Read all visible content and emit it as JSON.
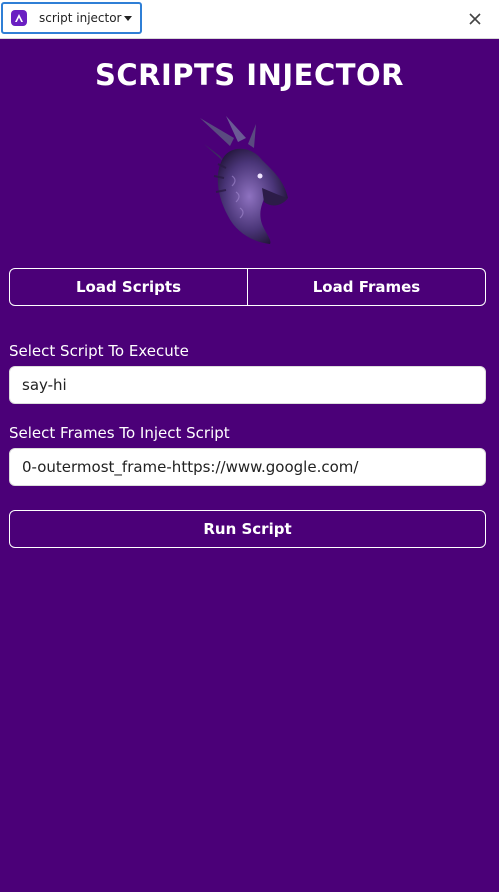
{
  "header": {
    "extension_name": "script injector",
    "icon": "extension-logo-icon",
    "close_icon": "close-icon"
  },
  "main": {
    "title": "SCRIPTS INJECTOR",
    "logo": "dragon-logo",
    "tabs": [
      {
        "label": "Load Scripts"
      },
      {
        "label": "Load Frames"
      }
    ],
    "script_select": {
      "label": "Select Script To Execute",
      "value": "say-hi"
    },
    "frames_select": {
      "label": "Select Frames To Inject Script",
      "value": "0-outermost_frame-https://www.google.com/"
    },
    "run_button": "Run Script"
  },
  "colors": {
    "background": "#4b0078",
    "text": "#ffffff",
    "accent": "#2f7fd6"
  }
}
